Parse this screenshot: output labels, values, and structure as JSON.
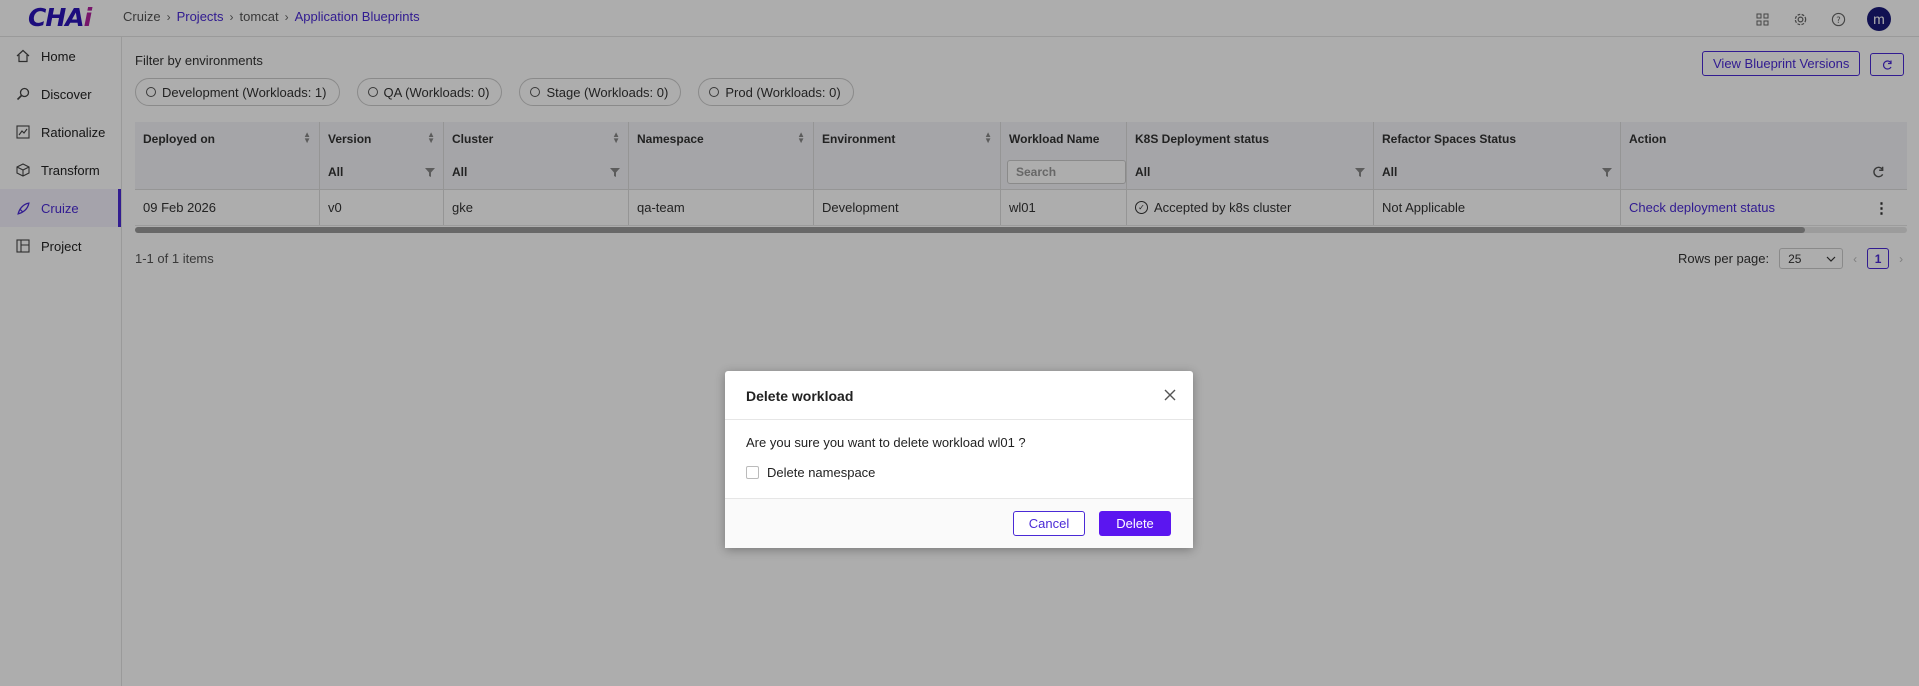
{
  "app": {
    "logo_main": "CHA",
    "logo_accent": "i"
  },
  "breadcrumb": [
    {
      "label": "Cruize",
      "link": false
    },
    {
      "label": "Projects",
      "link": true
    },
    {
      "label": "tomcat",
      "link": false
    },
    {
      "label": "Application Blueprints",
      "link": true
    }
  ],
  "header": {
    "avatar_initial": "m",
    "icons": [
      "grid-icon",
      "gear-icon",
      "help-icon"
    ]
  },
  "sidebar": {
    "items": [
      {
        "label": "Home",
        "icon": "home-icon",
        "active": false
      },
      {
        "label": "Discover",
        "icon": "discover-icon",
        "active": false
      },
      {
        "label": "Rationalize",
        "icon": "rationalize-icon",
        "active": false
      },
      {
        "label": "Transform",
        "icon": "cube-icon",
        "active": false
      },
      {
        "label": "Cruize",
        "icon": "rocket-icon",
        "active": true
      },
      {
        "label": "Project",
        "icon": "project-icon",
        "active": false
      }
    ]
  },
  "filter": {
    "title": "Filter by environments",
    "chips": [
      "Development (Workloads: 1)",
      "QA (Workloads: 0)",
      "Stage (Workloads: 0)",
      "Prod (Workloads: 0)"
    ]
  },
  "toolbar": {
    "view_versions_label": "View Blueprint Versions"
  },
  "table": {
    "columns": [
      {
        "header": "Deployed on",
        "filter": ""
      },
      {
        "header": "Version",
        "filter": "All"
      },
      {
        "header": "Cluster",
        "filter": "All"
      },
      {
        "header": "Namespace",
        "filter": ""
      },
      {
        "header": "Environment",
        "filter": ""
      },
      {
        "header": "Workload Name",
        "filter": ""
      },
      {
        "header": "K8S Deployment status",
        "filter": "All"
      },
      {
        "header": "Refactor Spaces Status",
        "filter": "All"
      },
      {
        "header": "Action",
        "filter": ""
      }
    ],
    "search_placeholder": "Search",
    "rows": [
      {
        "deployed_on": "09 Feb 2026",
        "version": "v0",
        "cluster": "gke",
        "namespace": "qa-team",
        "environment": "Development",
        "workload_name": "wl01",
        "k8s_status": "Accepted by k8s cluster",
        "refactor_status": "Not Applicable",
        "action": "Check deployment status"
      }
    ]
  },
  "pagination": {
    "items_label": "1-1 of 1 items",
    "rows_per_page_label": "Rows per page:",
    "rows_per_page_value": "25",
    "current_page": "1"
  },
  "modal": {
    "title": "Delete workload",
    "message": "Are you sure you want to delete workload wl01 ?",
    "checkbox_label": "Delete namespace",
    "cancel_label": "Cancel",
    "delete_label": "Delete"
  }
}
